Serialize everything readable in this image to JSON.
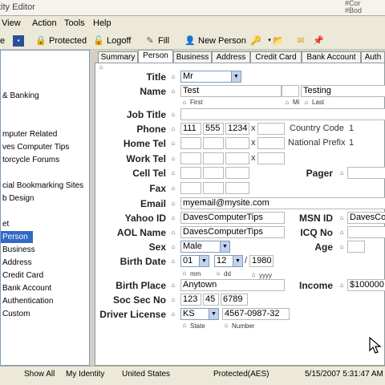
{
  "window": {
    "title": "tity Editor",
    "ghost_text": "#Cor\n#Bod"
  },
  "menu": [
    "View",
    "Action",
    "Tools",
    "Help"
  ],
  "toolbar": {
    "partial": "e",
    "protected": "Protected",
    "logoff": "Logoff",
    "fill": "Fill",
    "new_person": "New Person"
  },
  "sidebar": [
    {
      "label": "& Banking"
    },
    {
      "label": "mputer Related"
    },
    {
      "label": "ves Computer Tips"
    },
    {
      "label": "torcycle Forums"
    },
    {
      "label": "cial Bookmarking Sites"
    },
    {
      "label": "b Design"
    },
    {
      "label": "et"
    },
    {
      "label": "Person",
      "selected": true
    },
    {
      "label": "Business"
    },
    {
      "label": "Address"
    },
    {
      "label": "Credit Card"
    },
    {
      "label": "Bank Account"
    },
    {
      "label": "Authentication"
    },
    {
      "label": "Custom"
    }
  ],
  "tabs": [
    {
      "label": "Summary"
    },
    {
      "label": "Person",
      "active": true
    },
    {
      "label": "Business"
    },
    {
      "label": "Address"
    },
    {
      "label": "Credit Card"
    },
    {
      "label": "Bank Account"
    },
    {
      "label": "Auth"
    }
  ],
  "form": {
    "title_label": "Title",
    "title_value": "Mr",
    "name_label": "Name",
    "first": "Test",
    "middle": "",
    "last": "Testing",
    "first_sub": "First",
    "mi_sub": "Mi",
    "last_sub": "Last",
    "job_label": "Job Title",
    "phone_label": "Phone",
    "phone1": "111",
    "phone2": "555",
    "phone3": "1234",
    "x": "x",
    "country_code_label": "Country Code",
    "country_code": "1",
    "home_label": "Home Tel",
    "national_prefix_label": "National Prefix",
    "national_prefix": "1",
    "work_label": "Work Tel",
    "cell_label": "Cell Tel",
    "pager_label": "Pager",
    "fax_label": "Fax",
    "email_label": "Email",
    "email": "myemail@mysite.com",
    "yahoo_label": "Yahoo ID",
    "yahoo": "DavesComputerTips",
    "msn_label": "MSN ID",
    "msn": "DavesCo",
    "aol_label": "AOL Name",
    "aol": "DavesComputerTips",
    "icq_label": "ICQ No",
    "sex_label": "Sex",
    "sex": "Male",
    "age_label": "Age",
    "birth_label": "Birth Date",
    "bmonth": "01",
    "bday": "12",
    "byear": "1980",
    "mm": "mm",
    "dd_sub": "dd",
    "yyyy": "yyyy",
    "birthplace_label": "Birth Place",
    "birthplace": "Anytown",
    "income_label": "Income",
    "income": "$100000",
    "ssn_label": "Soc Sec No",
    "ssn1": "123",
    "ssn2": "45",
    "ssn3": "6789",
    "dl_label": "Driver License",
    "dl_state": "KS",
    "dl_number": "4567-0987-32",
    "state_sub": "State",
    "number_sub": "Number"
  },
  "status": {
    "show_all": "Show All",
    "identity": "My Identity",
    "country": "United States",
    "protection": "Protected(AES)",
    "datetime": "5/15/2007 5:31:47 AM"
  }
}
